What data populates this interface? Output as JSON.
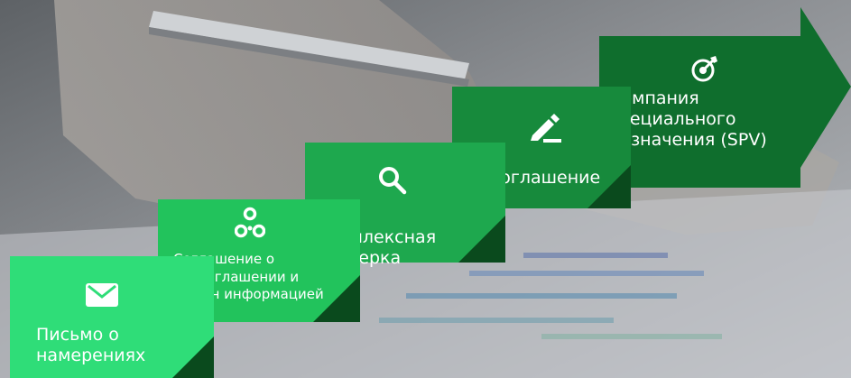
{
  "steps": [
    {
      "label": "Письмо о намерениях",
      "icon": "envelope-icon"
    },
    {
      "label": "Соглашение о неразглашении и Обмен информацией",
      "icon": "nodes-icon"
    },
    {
      "label": "Комплексная проверка",
      "icon": "search-icon"
    },
    {
      "label": "Соглашение",
      "icon": "pen-icon"
    },
    {
      "label": "Компания специального назначения (SPV)",
      "icon": "target-icon"
    }
  ],
  "colors": {
    "step1": "#2fdd78",
    "step2": "#22c35c",
    "step3": "#1ea84e",
    "step4": "#178a3c",
    "step5": "#0f6e2d",
    "fold": "#0a4a1d"
  }
}
